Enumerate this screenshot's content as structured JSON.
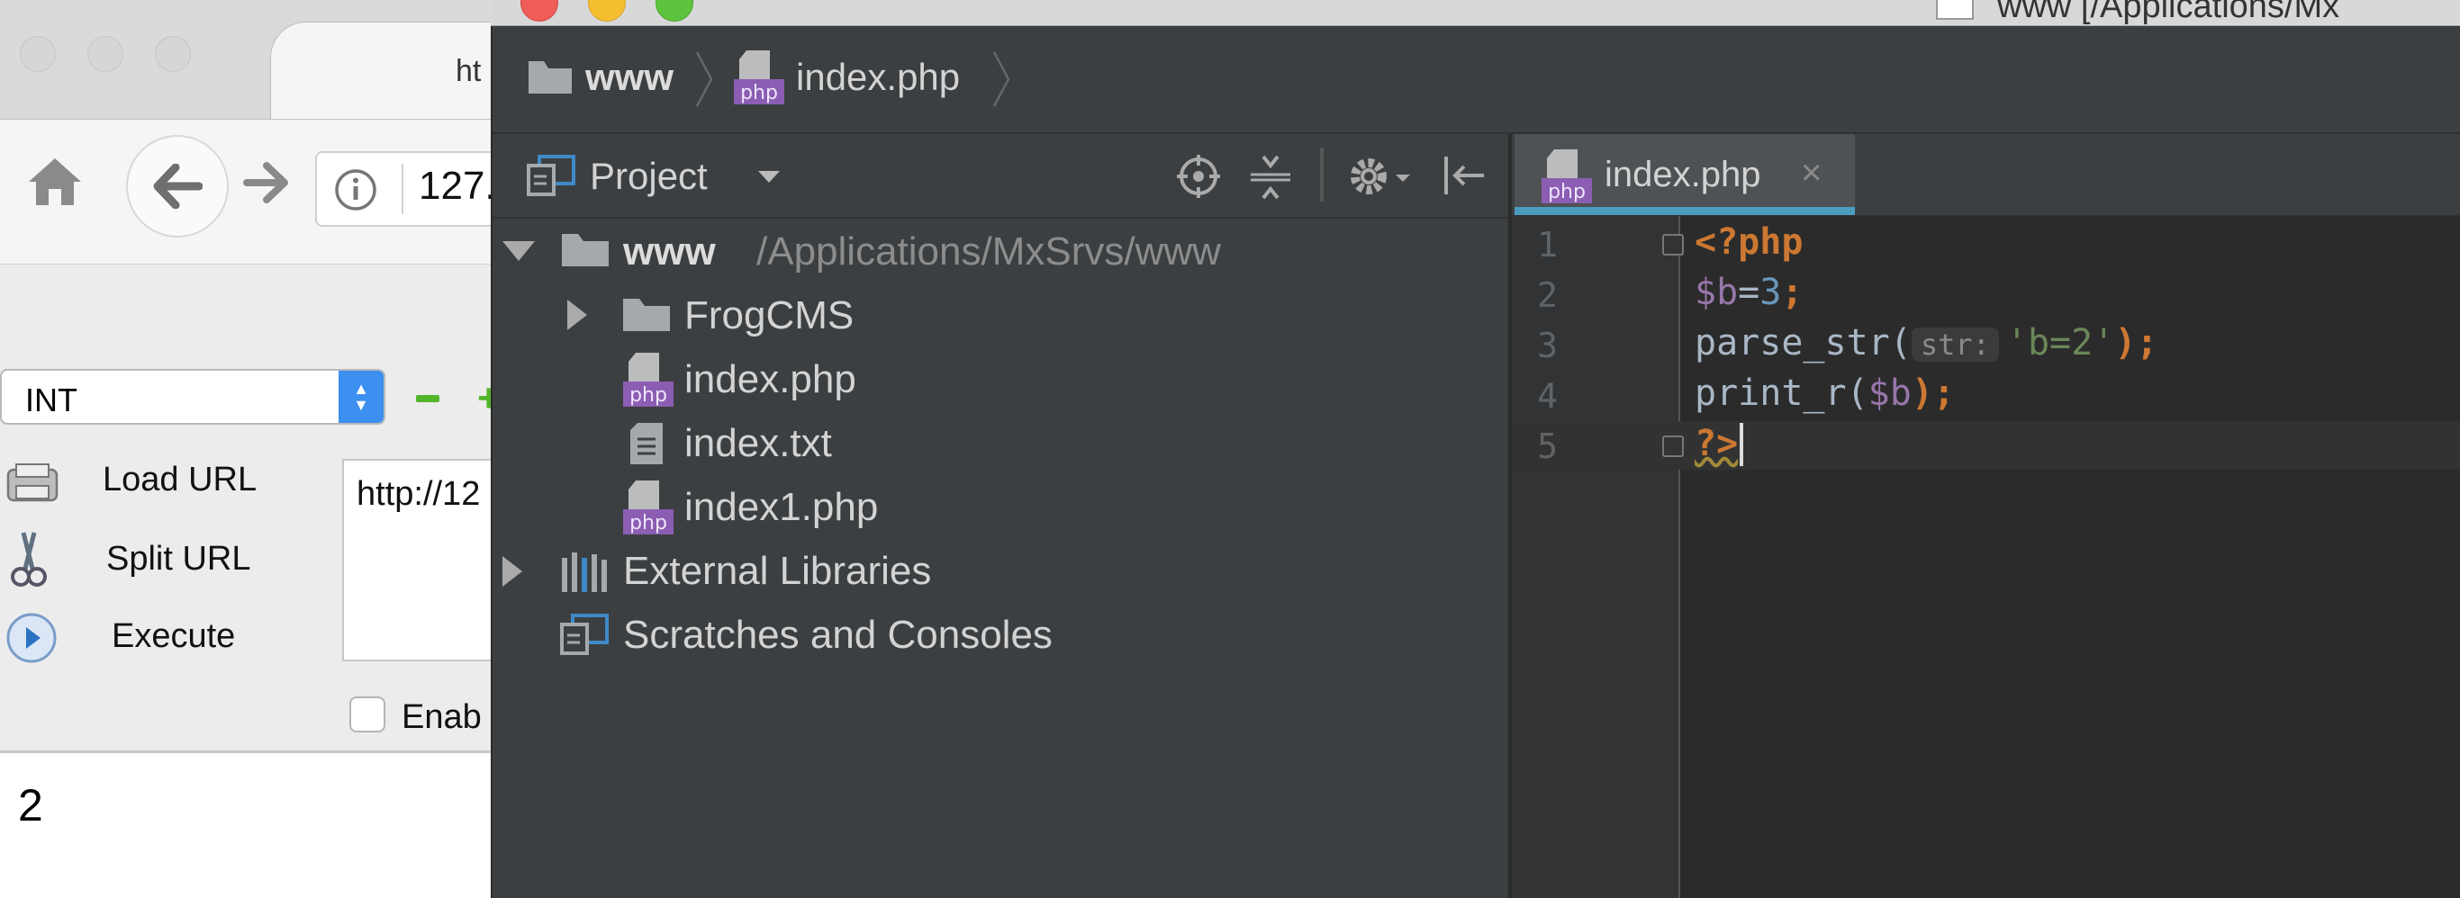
{
  "browser": {
    "tab_title": "ht",
    "url_text": "127.",
    "select_value": "INT",
    "hackbar": {
      "load_label": "Load URL",
      "split_label": "Split URL",
      "execute_label": "Execute",
      "url_field_value": "http://12",
      "enable_label": "Enab"
    },
    "output": "2"
  },
  "ide": {
    "title": "www [/Applications/Mx",
    "breadcrumb": {
      "project": "www",
      "file": "index.php"
    },
    "project_panel": {
      "title": "Project",
      "tree": {
        "root_name": "www",
        "root_path": "/Applications/MxSrvs/www",
        "folder": "FrogCMS",
        "file1": "index.php",
        "file2": "index.txt",
        "file3": "index1.php",
        "libraries": "External Libraries",
        "scratches": "Scratches and Consoles"
      }
    },
    "editor": {
      "tab_label": "index.php",
      "tab_close": "×",
      "line_numbers": [
        "1",
        "2",
        "3",
        "4",
        "5"
      ],
      "line1": "<?php",
      "line2_var": "$b",
      "line2_eq": "=",
      "line2_num": "3",
      "line2_end": ";",
      "line3_func": "parse_str(",
      "line3_hint": "str:",
      "line3_str": "'b=2'",
      "line3_end": ");",
      "line4_func": "print_r(",
      "line4_var": "$b",
      "line4_end": ");",
      "line5": "?>"
    },
    "colors": {
      "background": "#2b2b2b",
      "keyword": "#cc7832",
      "variable": "#9876aa",
      "number": "#6897bb",
      "string": "#6a8759",
      "tab_underline": "#4a9dbf"
    },
    "icons": {
      "php_file": "php-file-icon",
      "text_file": "text-file-icon",
      "folder": "folder-icon"
    }
  }
}
